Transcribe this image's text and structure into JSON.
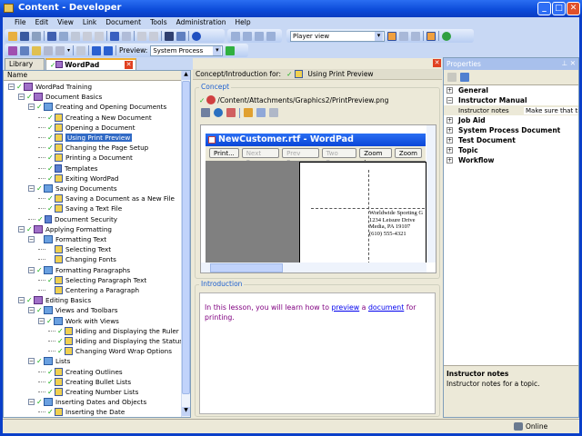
{
  "window": {
    "title": "Content - Developer"
  },
  "menu": [
    "File",
    "Edit",
    "View",
    "Link",
    "Document",
    "Tools",
    "Administration",
    "Help"
  ],
  "toolbar": {
    "view_select": "Player view",
    "preview_label": "Preview:",
    "preview_select": "System Process"
  },
  "tabs": [
    {
      "label": "Library"
    },
    {
      "label": "WordPad Training"
    }
  ],
  "tree": {
    "header": "Name",
    "rows": [
      {
        "l": 0,
        "t": "WordPad Training",
        "i": "book"
      },
      {
        "l": 1,
        "t": "Document Basics",
        "i": "book"
      },
      {
        "l": 2,
        "t": "Creating and Opening Documents",
        "i": "bookb"
      },
      {
        "l": 3,
        "t": "Creating a New Document",
        "i": "topic"
      },
      {
        "l": 3,
        "t": "Opening a Document",
        "i": "topic"
      },
      {
        "l": 3,
        "t": "Using Print Preview",
        "i": "topic",
        "sel": true
      },
      {
        "l": 3,
        "t": "Changing the Page Setup",
        "i": "topic"
      },
      {
        "l": 3,
        "t": "Printing a Document",
        "i": "topic"
      },
      {
        "l": 3,
        "t": "Templates",
        "i": "doc"
      },
      {
        "l": 3,
        "t": "Exiting WordPad",
        "i": "topic"
      },
      {
        "l": 2,
        "t": "Saving Documents",
        "i": "bookb"
      },
      {
        "l": 3,
        "t": "Saving a Document as a New File",
        "i": "topic"
      },
      {
        "l": 3,
        "t": "Saving a Text File",
        "i": "topic"
      },
      {
        "l": 2,
        "t": "Document Security",
        "i": "doc",
        "leaf": true
      },
      {
        "l": 1,
        "t": "Applying Formatting",
        "i": "book"
      },
      {
        "l": 2,
        "t": "Formatting Text",
        "i": "bookb",
        "nochk": true
      },
      {
        "l": 3,
        "t": "Selecting Text",
        "i": "topic",
        "nochk": true
      },
      {
        "l": 3,
        "t": "Changing Fonts",
        "i": "topic",
        "nochk": true
      },
      {
        "l": 2,
        "t": "Formatting Paragraphs",
        "i": "bookb"
      },
      {
        "l": 3,
        "t": "Selecting Paragraph Text",
        "i": "topic"
      },
      {
        "l": 3,
        "t": "Centering a Paragraph",
        "i": "topic",
        "nochk": true
      },
      {
        "l": 1,
        "t": "Editing Basics",
        "i": "book"
      },
      {
        "l": 2,
        "t": "Views and Toolbars",
        "i": "bookb"
      },
      {
        "l": 3,
        "t": "Work with Views",
        "i": "bookb"
      },
      {
        "l": 4,
        "t": "Hiding and Displaying the Ruler",
        "i": "topic"
      },
      {
        "l": 4,
        "t": "Hiding and Displaying the Status Bar",
        "i": "topic"
      },
      {
        "l": 4,
        "t": "Changing Word Wrap Options",
        "i": "topic"
      },
      {
        "l": 2,
        "t": "Lists",
        "i": "bookb"
      },
      {
        "l": 3,
        "t": "Creating Outlines",
        "i": "topic"
      },
      {
        "l": 3,
        "t": "Creating Bullet Lists",
        "i": "topic"
      },
      {
        "l": 3,
        "t": "Creating Number Lists",
        "i": "topic"
      },
      {
        "l": 2,
        "t": "Inserting Dates and Objects",
        "i": "bookb"
      },
      {
        "l": 3,
        "t": "Inserting the Date",
        "i": "topic"
      }
    ]
  },
  "editor": {
    "for_label": "Concept/Introduction for:",
    "for_value": "Using Print Preview",
    "concept_legend": "Concept",
    "concept_path": "/Content/Attachments/Graphics2/PrintPreview.png",
    "wordpad": {
      "title": "NewCustomer.rtf - WordPad",
      "buttons": [
        "Print...",
        "Next Page",
        "Prev Page",
        "Two Page",
        "Zoom In",
        "Zoom"
      ],
      "address": [
        "Worldwide Sporting G",
        "1234 Leisure Drive",
        "Media, PA 19107",
        "(610) 555-4321"
      ]
    },
    "intro_legend": "Introduction",
    "intro": {
      "before": "In this lesson, you will learn how to ",
      "link1": "preview",
      "mid": " a ",
      "link2": "document",
      "after": " for printing."
    }
  },
  "properties": {
    "title": "Properties",
    "items": [
      {
        "label": "General",
        "open": false
      },
      {
        "label": "Instructor Manual",
        "open": true
      },
      {
        "label": "Job Aid",
        "open": false
      },
      {
        "label": "System Process Document",
        "open": false
      },
      {
        "label": "Test Document",
        "open": false
      },
      {
        "label": "Topic",
        "open": false
      },
      {
        "label": "Workflow",
        "open": false
      }
    ],
    "sub_name": "Instructor notes",
    "sub_value": "Make sure that the prin...",
    "desc_title": "Instructor notes",
    "desc_text": "Instructor notes for a topic."
  },
  "status": {
    "online": "Online"
  }
}
